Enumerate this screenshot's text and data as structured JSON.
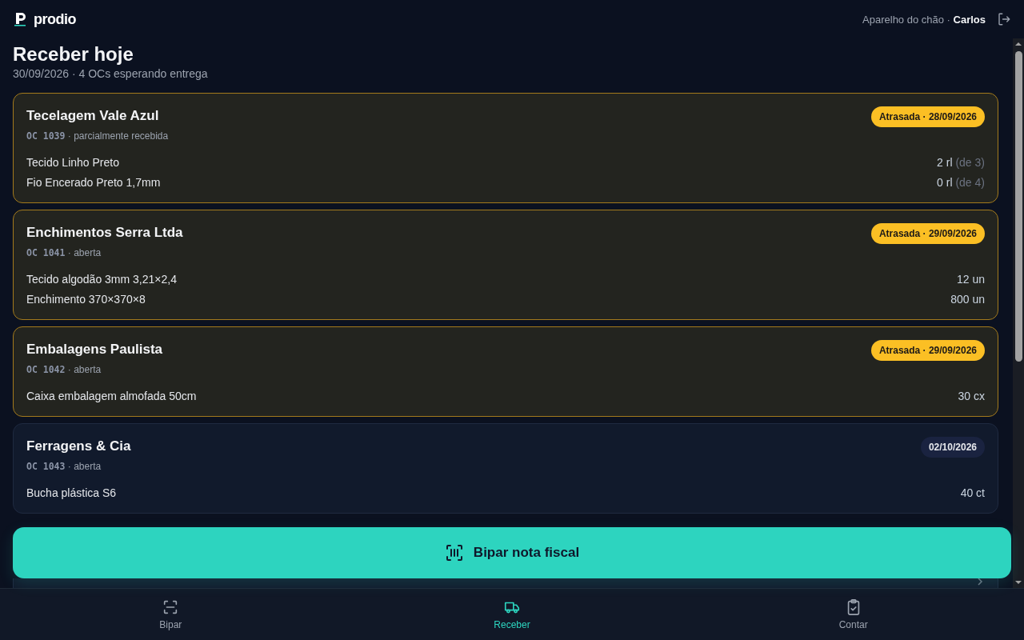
{
  "header": {
    "logo": "prodio",
    "device": "Aparelho do chão ·",
    "user": "Carlos"
  },
  "page": {
    "title": "Receber hoje",
    "subtitle": "30/09/2026 · 4 OCs esperando entrega"
  },
  "orders": [
    {
      "supplier": "Tecelagem Vale Azul",
      "code": "OC 1039",
      "status": "· parcialmente recebida",
      "late": true,
      "badge": "Atrasada · 28/09/2026",
      "items": [
        {
          "name": "Tecido Linho Preto",
          "qty": "2 rl",
          "of": "(de 3)"
        },
        {
          "name": "Fio Encerado Preto 1,7mm",
          "qty": "0 rl",
          "of": "(de 4)"
        }
      ]
    },
    {
      "supplier": "Enchimentos Serra Ltda",
      "code": "OC 1041",
      "status": "· aberta",
      "late": true,
      "badge": "Atrasada · 29/09/2026",
      "items": [
        {
          "name": "Tecido algodão 3mm 3,21×2,4",
          "qty": "12 un"
        },
        {
          "name": "Enchimento 370×370×8",
          "qty": "800 un"
        }
      ]
    },
    {
      "supplier": "Embalagens Paulista",
      "code": "OC 1042",
      "status": "· aberta",
      "late": true,
      "badge": "Atrasada · 29/09/2026",
      "items": [
        {
          "name": "Caixa embalagem almofada 50cm",
          "qty": "30 cx"
        }
      ]
    },
    {
      "supplier": "Ferragens & Cia",
      "code": "OC 1043",
      "status": "· aberta",
      "late": false,
      "badge": "02/10/2026",
      "items": [
        {
          "name": "Bucha plástica S6",
          "qty": "40 ct"
        }
      ]
    }
  ],
  "action_button": {
    "label": "Bipar nota fiscal"
  },
  "nav": [
    {
      "label": "Bipar",
      "kind": "scan",
      "selected": false
    },
    {
      "label": "Receber",
      "kind": "truck",
      "selected": true
    },
    {
      "label": "Contar",
      "kind": "clipboard",
      "selected": false
    }
  ]
}
